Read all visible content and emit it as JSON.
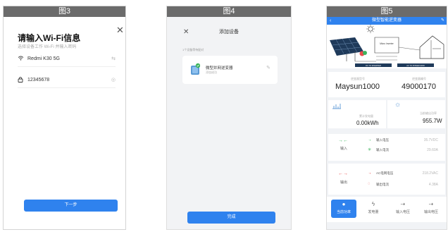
{
  "panel1": {
    "label": "图3",
    "title": "请输入Wi-Fi信息",
    "subtitle": "选择设备工作 Wi-Fi 并输入密码",
    "ssid": "Redmi K30 5G",
    "password": "12345678",
    "next_button": "下一步",
    "icons": {
      "close": "close-icon",
      "wifi": "wifi-icon",
      "lock": "lock-icon",
      "switch": "switch-icon",
      "eye": "eye-icon"
    }
  },
  "panel2": {
    "label": "图4",
    "title": "添加设备",
    "hint": "1个设备等待配对",
    "device_name": "微型并网逆变器",
    "device_state": "添加成功",
    "done_button": "完成",
    "icons": {
      "close": "close-icon",
      "device": "inverter-icon",
      "check": "check-icon",
      "edit": "pencil-icon"
    }
  },
  "panel3": {
    "label": "图5",
    "title": "微型智能逆变器",
    "diagram": {
      "label_left": "DC TO INVERTER",
      "label_right": "AC TO POWER GRID",
      "inverter_text": "Micro Inverter"
    },
    "model_label": "逆变器型号",
    "model_value": "Maysun1000",
    "serial_label": "逆变器编号",
    "serial_value": "49000170",
    "energy_label": "累计发电量",
    "energy_value": "0.00kWh",
    "power_label": "当前输出功率",
    "power_value": "955.7W",
    "input": {
      "label": "输入",
      "rows": [
        {
          "name": "输入电压",
          "value": "35.7VDC"
        },
        {
          "name": "输入电流",
          "value": "29.60A"
        }
      ]
    },
    "output": {
      "label": "输出",
      "rows": [
        {
          "name": "AC电网电压",
          "value": "218.2VAC"
        },
        {
          "name": "输出电流",
          "value": "4.38A"
        }
      ]
    },
    "tabs": [
      {
        "label": "当前功率",
        "icon": "power-icon"
      },
      {
        "label": "发电量",
        "icon": "bolt-icon"
      },
      {
        "label": "输入电压",
        "icon": "voltage-icon"
      },
      {
        "label": "输出电压",
        "icon": "voltage-out-icon"
      }
    ],
    "colors": {
      "accent": "#2f82ee",
      "green": "#3bb45c",
      "red": "#e94b4b",
      "orange": "#f39c12"
    }
  }
}
